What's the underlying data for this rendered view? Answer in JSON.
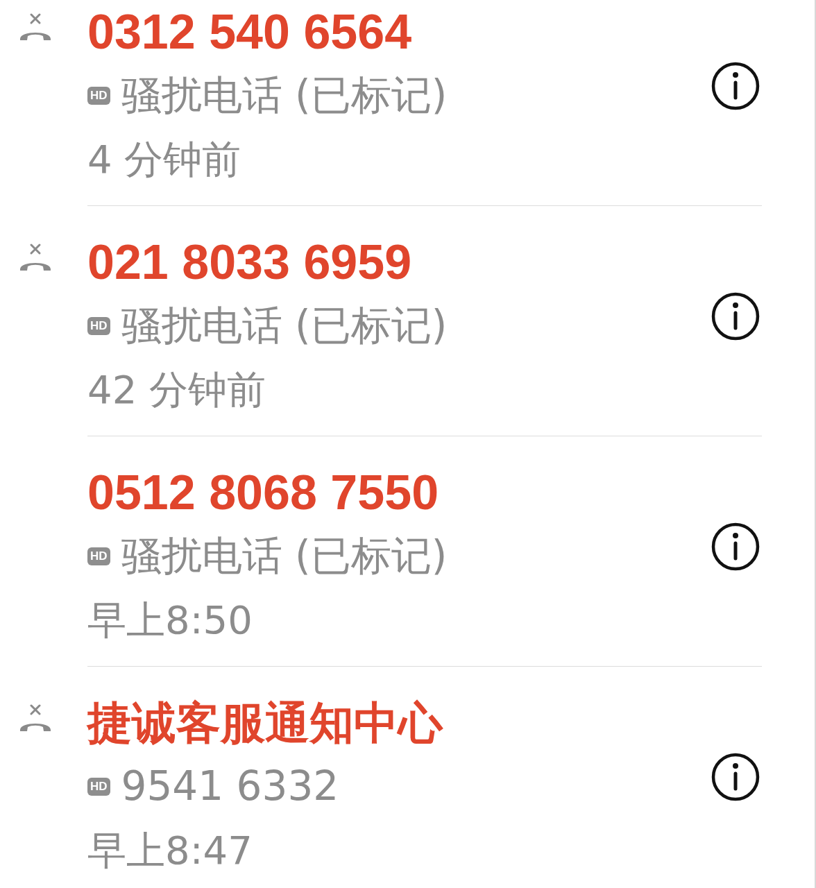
{
  "calls": [
    {
      "missed": true,
      "name": "0312 540 6564",
      "badge": "HD",
      "detail": "骚扰电话 (已标记)",
      "time": "4 分钟前"
    },
    {
      "missed": true,
      "name": "021 8033 6959",
      "badge": "HD",
      "detail": "骚扰电话 (已标记)",
      "time": "42 分钟前"
    },
    {
      "missed": false,
      "name": "0512 8068 7550",
      "badge": "HD",
      "detail": "骚扰电话 (已标记)",
      "time": "早上8:50"
    },
    {
      "missed": true,
      "name": "捷诚客服通知中心",
      "badge": "HD",
      "detail": "9541 6332",
      "time": "早上8:47"
    }
  ]
}
